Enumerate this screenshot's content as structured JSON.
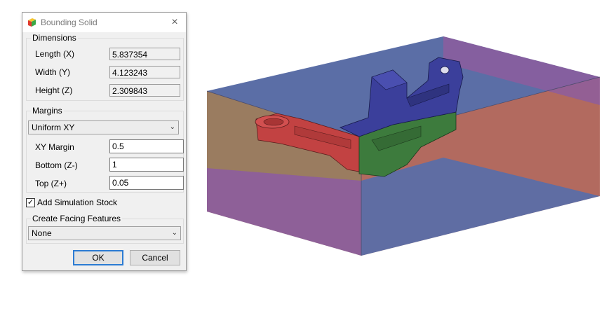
{
  "dialog": {
    "title": "Bounding Solid",
    "close_icon": "×",
    "dimensions": {
      "legend": "Dimensions",
      "length_label": "Length (X)",
      "length_value": "5.837354",
      "width_label": "Width (Y)",
      "width_value": "4.123243",
      "height_label": "Height (Z)",
      "height_value": "2.309843"
    },
    "margins": {
      "legend": "Margins",
      "mode_value": "Uniform XY",
      "xy_label": "XY Margin",
      "xy_value": "0.5",
      "bottom_label": "Bottom (Z-)",
      "bottom_value": "1",
      "top_label": "Top (Z+)",
      "top_value": "0.05"
    },
    "add_stock": {
      "label": "Add Simulation Stock",
      "checked": true
    },
    "facing": {
      "legend": "Create Facing Features",
      "value": "None"
    },
    "ok_label": "OK",
    "cancel_label": "Cancel"
  },
  "icons": {
    "app": "bounding-box-icon",
    "close": "close-icon",
    "dropdown": "chevron-down-icon",
    "check": "checkmark-icon"
  },
  "colors": {
    "accent": "#2b7bd3",
    "box_top": "#5a6fa5",
    "box_left": "#9b7a5a",
    "box_right": "#b06a60",
    "box_bottom": "#5a6fa5",
    "box_purple": "#8d5d9e",
    "part_red": "#c04040",
    "part_blue": "#3a3f9a",
    "part_green": "#3c7a3c"
  }
}
